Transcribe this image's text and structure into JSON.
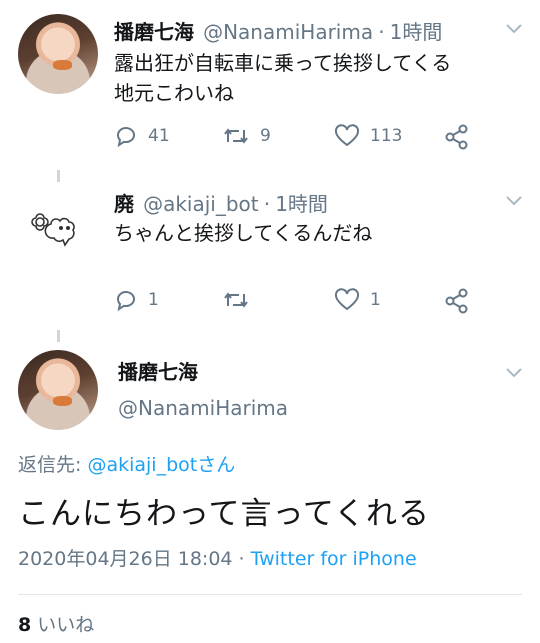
{
  "tweet1": {
    "display_name": "播磨七海",
    "handle": "@NanamiHarima",
    "dot": "·",
    "time": "1時間",
    "text_line1": "露出狂が自転車に乗って挨拶してくる",
    "text_line2": "地元こわいね",
    "reply_count": "41",
    "retweet_count": "9",
    "like_count": "113"
  },
  "tweet2": {
    "display_name": "廃",
    "handle": "@akiaji_bot",
    "dot": "·",
    "time": "1時間",
    "text": "ちゃんと挨拶してくるんだね",
    "reply_count": "1",
    "retweet_count": "",
    "like_count": "1"
  },
  "focused": {
    "display_name": "播磨七海",
    "handle": "@NanamiHarima",
    "reply_prefix": "返信先: ",
    "reply_mention": "@akiaji_botさん",
    "text": "こんにちわって言ってくれる",
    "date": "2020年04月26日 18:04",
    "dot": " · ",
    "client": "Twitter for iPhone",
    "likes_count": "8",
    "likes_label": "いいね"
  },
  "colors": {
    "accent": "#1da1f2",
    "muted": "#657786"
  },
  "icons": [
    "chevron-down-icon",
    "reply-icon",
    "retweet-icon",
    "like-icon",
    "share-icon",
    "flower-mascot-icon"
  ]
}
